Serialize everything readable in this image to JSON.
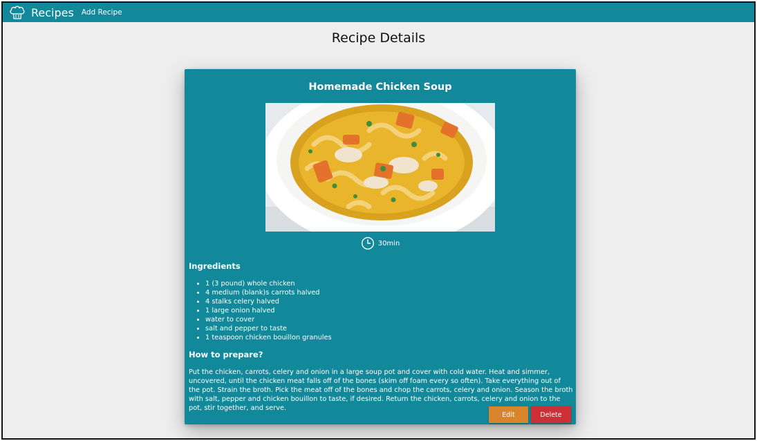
{
  "navbar": {
    "brand": "Recipes",
    "add_recipe_link": "Add Recipe",
    "logo_icon": "chef-hat-icon"
  },
  "page": {
    "title": "Recipe Details"
  },
  "recipe": {
    "title": "Homemade Chicken Soup",
    "time": "30min",
    "ingredients_heading": "Ingredients",
    "ingredients": [
      "1 (3 pound) whole chicken",
      "4 medium (blank)s carrots halved",
      "4 stalks celery halved",
      "1 large onion halved",
      "water to cover",
      "salt and pepper to taste",
      "1 teaspoon chicken bouillon granules"
    ],
    "instructions_heading": "How to prepare?",
    "instructions": "Put the chicken, carrots, celery and onion in a large soup pot and cover with cold water. Heat and simmer, uncovered, until the chicken meat falls off of the bones (skim off foam every so often). Take everything out of the pot. Strain the broth. Pick the meat off of the bones and chop the carrots, celery and onion. Season the broth with salt, pepper and chicken bouillon to taste, if desired. Return the chicken, carrots, celery and onion to the pot, stir together, and serve."
  },
  "actions": {
    "edit_label": "Edit",
    "delete_label": "Delete"
  },
  "colors": {
    "primary": "#12889b",
    "background": "#eeeeee",
    "edit_button": "#d9862b",
    "delete_button": "#cc2f35"
  }
}
